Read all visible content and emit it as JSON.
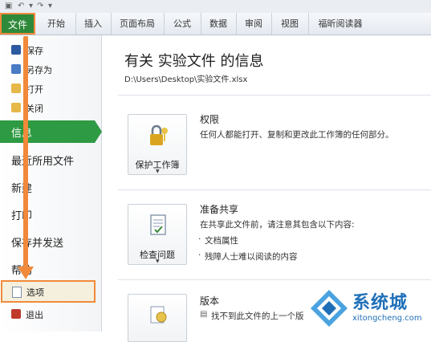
{
  "ribbon": {
    "file_tab": "文件",
    "tabs": [
      "开始",
      "插入",
      "页面布局",
      "公式",
      "数据",
      "审阅",
      "视图",
      "福昕阅读器"
    ]
  },
  "nav": {
    "save": "保存",
    "save_as": "另存为",
    "open": "打开",
    "close": "关闭",
    "info": "信息",
    "recent": "最近所用文件",
    "new": "新建",
    "print": "打印",
    "save_send": "保存并发送",
    "help": "帮助",
    "options": "选项",
    "exit": "退出"
  },
  "main": {
    "title": "有关 实验文件 的信息",
    "path": "D:\\Users\\Desktop\\实验文件.xlsx",
    "permissions": {
      "button": "保护工作簿",
      "heading": "权限",
      "text": "任何人都能打开、复制和更改此工作簿的任何部分。"
    },
    "prepare": {
      "button": "检查问题",
      "heading": "准备共享",
      "text": "在共享此文件前，请注意其包含以下内容:",
      "bullets": [
        "文档属性",
        "残障人士难以阅读的内容"
      ]
    },
    "versions": {
      "heading": "版本",
      "text": "找不到此文件的上一个版"
    }
  },
  "watermark": {
    "brand": "系统城",
    "url": "xitongcheng.com",
    "colors": {
      "blue": "#1f6fb8",
      "light_blue": "#4aa3e0"
    }
  },
  "colors": {
    "file_green": "#2e8a3a",
    "highlight_orange": "#f08a3c",
    "selected_green": "#2e9a43"
  }
}
